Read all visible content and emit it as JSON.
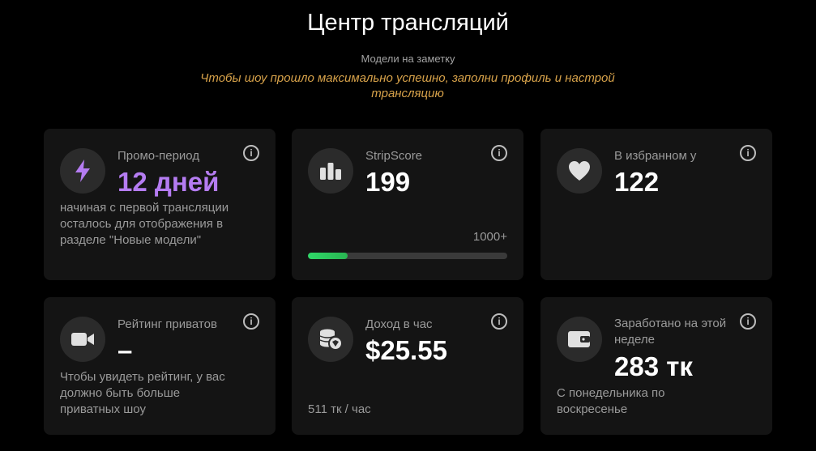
{
  "header": {
    "title": "Центр трансляций",
    "notes_label": "Модели на заметку",
    "notes_text": "Чтобы шоу прошло максимально успешно, заполни профиль и настрой трансляцию"
  },
  "cards": {
    "promo": {
      "icon": "lightning-icon",
      "label": "Промо-период",
      "value": "12 дней",
      "desc": "начиная с первой трансляции осталось для отображения в разделе \"Новые модели\"",
      "value_color": "#b57cf2"
    },
    "stripscore": {
      "icon": "bar-chart-icon",
      "label": "StripScore",
      "value": "199",
      "max_label": "1000+",
      "progress": 0.199,
      "progress_color": "#2fd868"
    },
    "favorites": {
      "icon": "heart-icon",
      "label": "В избранном у",
      "value": "122"
    },
    "private_rating": {
      "icon": "video-camera-icon",
      "label": "Рейтинг приватов",
      "value": "–",
      "desc": "Чтобы увидеть рейтинг, у вас должно быть больше приватных шоу"
    },
    "hourly_income": {
      "icon": "coins-icon",
      "label": "Доход в час",
      "value": "$25.55",
      "desc": "511 тк / час"
    },
    "weekly_earned": {
      "icon": "wallet-icon",
      "label": "Заработано на этой неделе",
      "value": "283 тк",
      "desc": "С понедельника по воскресенье"
    }
  },
  "info_glyph": "i",
  "colors": {
    "background": "#000000",
    "card": "#141414",
    "accent_orange": "#d7a24a",
    "accent_purple": "#b57cf2"
  }
}
